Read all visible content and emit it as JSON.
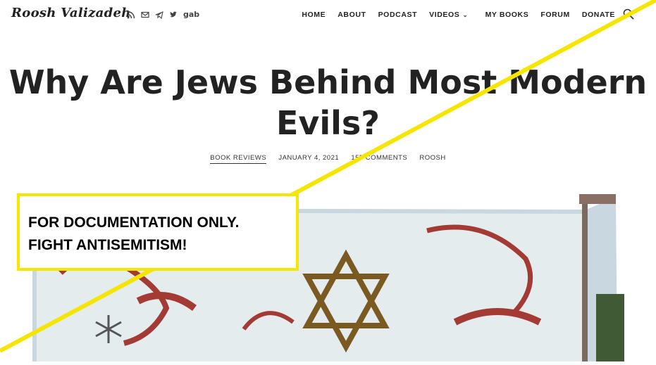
{
  "site": {
    "logo": "Roosh Valizadeh",
    "social_icons": [
      "rss-icon",
      "email-icon",
      "telegram-icon",
      "twitter-icon"
    ],
    "gab": "gab"
  },
  "nav": {
    "items": [
      "HOME",
      "ABOUT",
      "PODCAST",
      "VIDEOS",
      "MY BOOKS",
      "FORUM",
      "DONATE"
    ]
  },
  "article": {
    "title_line1": "Why Are Jews Behind Most Modern",
    "title_line2": "Evils?",
    "category": "BOOK REVIEWS",
    "date": "JANUARY 4, 2021",
    "comments": "155 COMMENTS",
    "author": "ROOSH"
  },
  "overlay": {
    "line1": "FOR DOCUMENTATION ONLY.",
    "line2": "FIGHT ANTISEMITISM!",
    "color": "#f5e600"
  }
}
